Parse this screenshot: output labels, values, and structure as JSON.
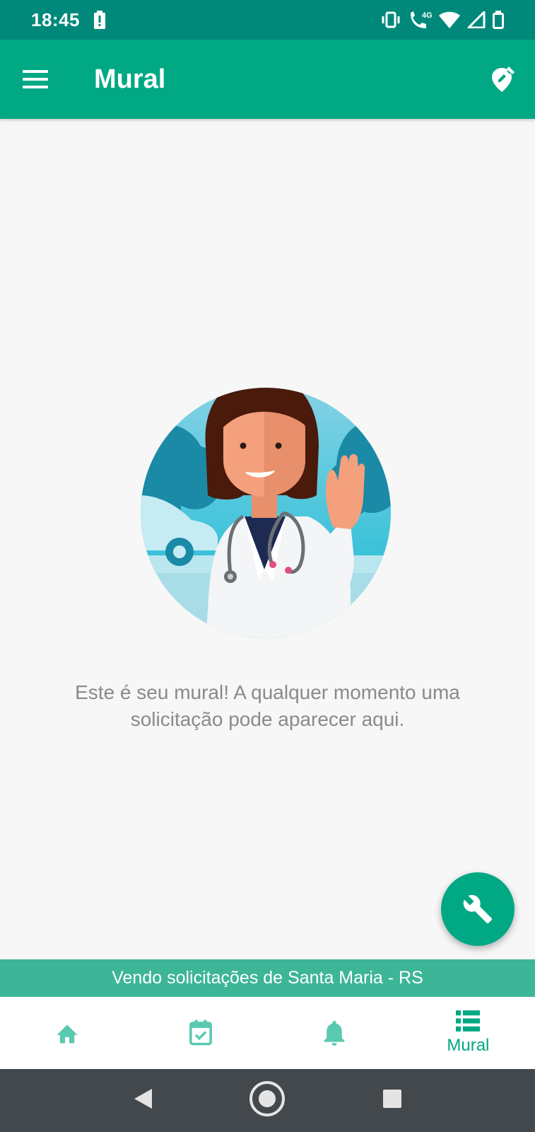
{
  "status_bar": {
    "time": "18:45",
    "network_label": "4G"
  },
  "app_bar": {
    "title": "Mural"
  },
  "empty_state": {
    "message": "Este é seu mural! A qualquer momento uma solicitação pode aparecer aqui."
  },
  "location_banner": {
    "text": "Vendo solicitações de Santa Maria - RS"
  },
  "bottom_nav": {
    "items": [
      {
        "icon": "home-icon",
        "label": ""
      },
      {
        "icon": "calendar-check-icon",
        "label": ""
      },
      {
        "icon": "bell-icon",
        "label": ""
      },
      {
        "icon": "list-icon",
        "label": "Mural"
      }
    ]
  },
  "colors": {
    "primary": "#00a884",
    "status_bar": "#00897b",
    "banner": "#3db597",
    "system_nav": "#43484d",
    "message_text": "#8a8a8a"
  }
}
